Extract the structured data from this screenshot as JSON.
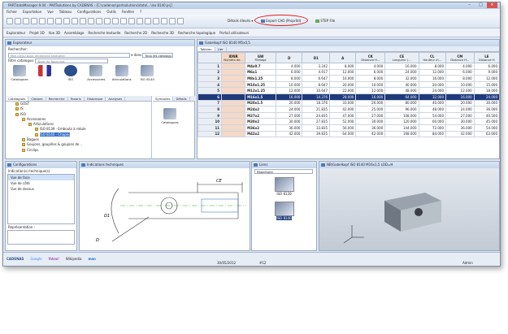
{
  "window": {
    "title": "PARTdataManager 9.04 - PARTsolutions by CADENAS - [C:\\cadenas\\partsolutions\\data\\...\\iso 8140.prj]"
  },
  "menu": [
    "Fichier",
    "Exportation",
    "Vue",
    "Tableau",
    "Configurations",
    "Outils",
    "Fenêtre",
    "?"
  ],
  "toolbar": {
    "details": "Détails élevés",
    "export_cad": "Export CAO (Propr0d)",
    "step": "STEP File"
  },
  "toolbar2": [
    "Explorateur",
    "Projet 3D",
    "Vue 3D",
    "Assemblage",
    "Recherche textuelle",
    "Recherche 2D",
    "Recherche 3D",
    "Recherche topologique",
    "Portail utilisateurs"
  ],
  "explorer": {
    "title": "Explorateur",
    "search_label": "Rechercher:",
    "search_placeholder": "Mot clé(s) pour recherche textuelle",
    "in_label": "dans",
    "all_catalogs": "Tous les catalogu",
    "filter_label": "Filtre catalogue:",
    "filter_placeholder": "Nom du fabricant"
  },
  "catalog_icons": [
    "Catalogues",
    "",
    "ISO",
    "Accessoires",
    "Articulations",
    "ISO 8140"
  ],
  "explorer_tabs": [
    "Catalogues",
    "Classes",
    "Recherche",
    "Favoris",
    "Historique",
    "Analyses"
  ],
  "symbols_tabs": [
    "Symboles",
    "Détails"
  ],
  "symbol_label": "Catalogues",
  "tree": [
    {
      "label": "GOST",
      "depth": 1
    },
    {
      "label": "IS",
      "depth": 1
    },
    {
      "label": "ISO",
      "depth": 1
    },
    {
      "label": "Accessoires",
      "depth": 2
    },
    {
      "label": "Articulations",
      "depth": 3
    },
    {
      "label": "ISO 8139 - Embouts à rotule",
      "depth": 4
    },
    {
      "label": "ISO 8140 - Chapes",
      "depth": 4,
      "selected": true
    },
    {
      "label": "Bagues",
      "depth": 2
    },
    {
      "label": "Goujons, goupilles & goujons de ..",
      "depth": 2
    },
    {
      "label": "Circlips",
      "depth": 2
    }
  ],
  "table": {
    "title": "Gabelkopf ISO 8140 M5x0,5",
    "tabs": [
      "Tableau",
      "Lier"
    ],
    "headers": [
      "",
      "IDNR",
      "GW",
      "D",
      "D1",
      "A",
      "CK",
      "CE",
      "CL",
      "CM",
      "LE"
    ],
    "subheaders": [
      "",
      "Numéro de...",
      "Filetage",
      "",
      "",
      "",
      "Distance H...",
      "Longueur (...",
      "Hauteur m...",
      "Distance H...",
      "Distance H"
    ],
    "rows": [
      [
        "1",
        "",
        "M4x0.7",
        "4.000",
        "3.242",
        "8.000",
        "4.000",
        "16.000",
        "8.000",
        "4.000",
        "6.000"
      ],
      [
        "2",
        "",
        "M6x1",
        "6.000",
        "4.917",
        "12.000",
        "6.000",
        "24.000",
        "12.000",
        "6.000",
        "9.000"
      ],
      [
        "3",
        "",
        "M8x1.25",
        "8.000",
        "6.647",
        "16.000",
        "8.000",
        "32.000",
        "16.000",
        "8.000",
        "12.000"
      ],
      [
        "4",
        "",
        "M10x1.25",
        "10.000",
        "8.647",
        "20.000",
        "10.000",
        "40.000",
        "20.000",
        "10.000",
        "15.000"
      ],
      [
        "5",
        "",
        "M12x1.25",
        "12.000",
        "10.647",
        "22.000",
        "12.000",
        "48.000",
        "24.000",
        "12.000",
        "18.000"
      ],
      [
        "6",
        "",
        "M16x1.5",
        "16.000",
        "14.376",
        "28.000",
        "16.000",
        "64.000",
        "32.000",
        "16.000",
        "24.000"
      ],
      [
        "7",
        "",
        "M20x1.5",
        "20.000",
        "18.376",
        "33.000",
        "20.000",
        "80.000",
        "40.000",
        "20.000",
        "30.000"
      ],
      [
        "8",
        "",
        "M24x2",
        "24.000",
        "21.835",
        "42.000",
        "25.000",
        "96.000",
        "48.000",
        "24.000",
        "36.000"
      ],
      [
        "9",
        "",
        "M27x2",
        "27.000",
        "24.835",
        "47.000",
        "27.000",
        "108.000",
        "54.000",
        "27.000",
        "40.500"
      ],
      [
        "10",
        "",
        "M30x2",
        "30.000",
        "27.835",
        "52.000",
        "30.000",
        "120.000",
        "60.000",
        "30.000",
        "45.000"
      ],
      [
        "11",
        "",
        "M36x2",
        "36.000",
        "33.835",
        "56.000",
        "36.000",
        "144.000",
        "72.000",
        "36.000",
        "54.000"
      ],
      [
        "12",
        "",
        "M42x2",
        "42.000",
        "39.835",
        "64.000",
        "42.000",
        "168.000",
        "84.000",
        "42.000",
        "63.000"
      ]
    ],
    "selected_row": 5
  },
  "configurations": {
    "title": "Configurations",
    "label": "Indication(s) technique(s)",
    "items": [
      "Vue de face",
      "Vue de côté",
      "Vue de dessus"
    ],
    "repr_label": "Représentation :"
  },
  "technical": {
    "title": "Indications techniques",
    "dim_ce": "CE",
    "dim_d": "D",
    "dim_d1": "D1"
  },
  "links": {
    "title": "Liens",
    "select": "Répertoire",
    "items": [
      "ISO 8139",
      "ISO 8140"
    ]
  },
  "viewer": {
    "title": "NB\\Gabelkopf ISO 8140 M16x1,5 LOD=H"
  },
  "status": {
    "logos": [
      "CADENAS",
      "Google",
      "Yahoo!",
      "Wikipedia",
      "msn"
    ],
    "date": "30/05/2012",
    "page": "#12",
    "user": "Admin"
  },
  "colors": {
    "selection": "#1f3a7a",
    "accent": "#e01b1b"
  }
}
